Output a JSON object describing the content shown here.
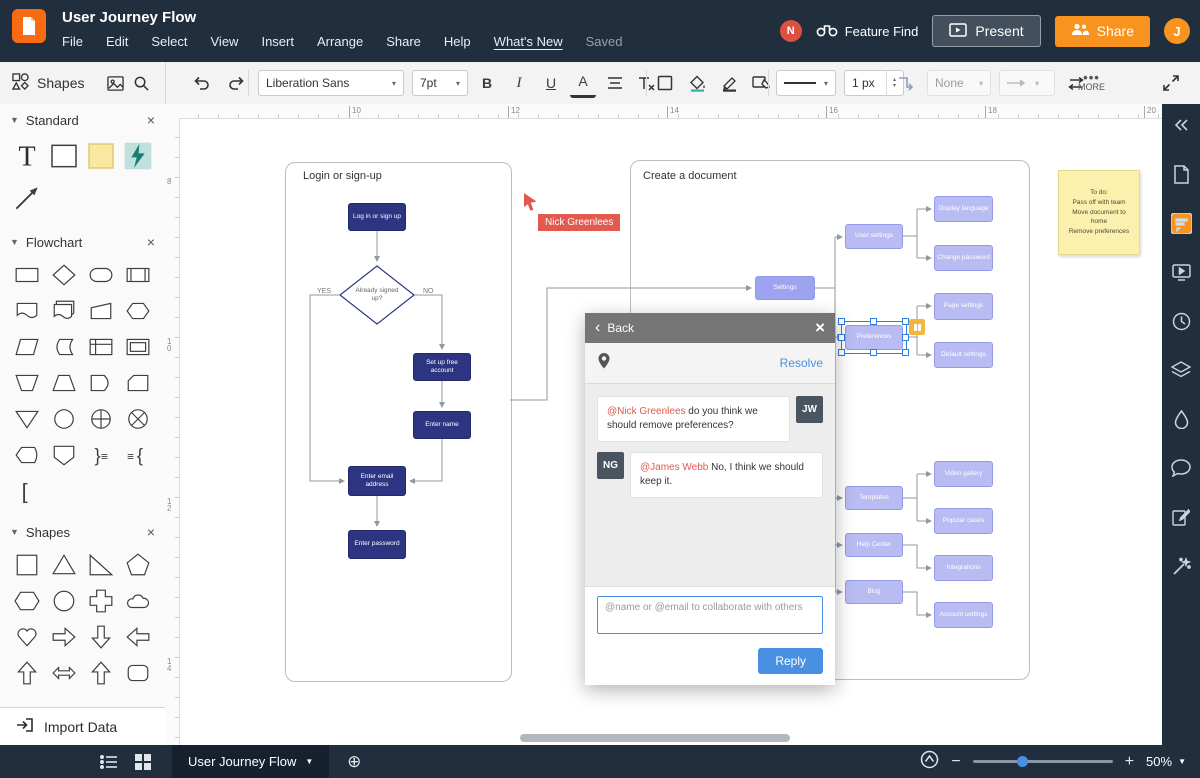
{
  "header": {
    "title": "User Journey Flow",
    "menu": [
      "File",
      "Edit",
      "Select",
      "View",
      "Insert",
      "Arrange",
      "Share",
      "Help",
      "What's New",
      "Saved"
    ],
    "avatar_small": "N",
    "feature_find": "Feature Find",
    "present": "Present",
    "share": "Share",
    "avatar_user": "J"
  },
  "toolbar": {
    "shapes_label": "Shapes",
    "font_name": "Liberation Sans",
    "font_size": "7pt",
    "bold_label": "B",
    "italic_label": "I",
    "underline_label": "U",
    "color_label": "A",
    "line_width": "1 px",
    "line_end": "None",
    "more_label": "MORE"
  },
  "left_panel": {
    "sections": [
      {
        "title": "Standard",
        "shapes": [
          "text",
          "rectangle",
          "sticky-note",
          "lightning",
          "arrow"
        ]
      },
      {
        "title": "Flowchart",
        "shapes": [
          "process",
          "decision",
          "terminator",
          "predefined-process",
          "document",
          "tagged-document",
          "manual-input",
          "preparation",
          "data",
          "stored-data",
          "internal-storage",
          "framed-rect",
          "manual-operation",
          "trapezoid",
          "delay",
          "card",
          "merge",
          "connector",
          "or-junction",
          "summing-junction",
          "display",
          "off-page",
          "brace-right",
          "brace-left",
          "bracket"
        ]
      },
      {
        "title": "Shapes",
        "shapes": [
          "square",
          "triangle",
          "right-triangle",
          "pentagon",
          "hexagon",
          "circle",
          "cross",
          "cloud",
          "heart",
          "arrow-right",
          "arrow-down",
          "arrow-left",
          "arrow-up",
          "arrow-left-right",
          "arrow-up-hollow",
          "rounded-rect"
        ]
      }
    ],
    "import_label": "Import Data"
  },
  "canvas": {
    "ruler_top_labels": [
      "10",
      "12",
      "14",
      "16",
      "18",
      "20"
    ],
    "ruler_left_labels": [
      "8",
      "10",
      "12",
      "14"
    ],
    "login_group_title": "Login or sign-up",
    "doc_group_title": "Create a document",
    "yes_label": "YES",
    "no_label": "NO",
    "login_nodes": [
      {
        "id": "login",
        "label": "Log in or sign up"
      },
      {
        "id": "signup-q",
        "label": "Already signed up?"
      },
      {
        "id": "setup",
        "label": "Set up free account"
      },
      {
        "id": "name",
        "label": "Enter name"
      },
      {
        "id": "email",
        "label": "Enter email address"
      },
      {
        "id": "password",
        "label": "Enter password"
      }
    ],
    "doc_nodes": [
      {
        "id": "settings",
        "label": "Settings"
      },
      {
        "id": "user-settings",
        "label": "User settings"
      },
      {
        "id": "display-language",
        "label": "Display language"
      },
      {
        "id": "change-password",
        "label": "Change password"
      },
      {
        "id": "page-settings",
        "label": "Page settings"
      },
      {
        "id": "preferences",
        "label": "Preferences",
        "selected": true
      },
      {
        "id": "default-settings",
        "label": "Default settings"
      },
      {
        "id": "templates",
        "label": "Templates"
      },
      {
        "id": "video-gallery",
        "label": "Video gallery"
      },
      {
        "id": "popular-cases",
        "label": "Popular cases"
      },
      {
        "id": "help-center",
        "label": "Help Center"
      },
      {
        "id": "integrations",
        "label": "Integrations"
      },
      {
        "id": "blog",
        "label": "Blog"
      },
      {
        "id": "account-settings",
        "label": "Account settings"
      }
    ],
    "cursor_label": "Nick Greenlees",
    "sticky_note_lines": [
      "To do:",
      "Pass off with team",
      "Move document to",
      "home",
      "Remove preferences"
    ]
  },
  "comment_popup": {
    "back_label": "Back",
    "resolve_label": "Resolve",
    "comments": [
      {
        "avatar": "JW",
        "mention": "@Nick Greenlees",
        "text": " do you think we should remove preferences?",
        "avatar_side": "right"
      },
      {
        "avatar": "NG",
        "mention": "@James Webb",
        "text": " No, I think we should keep it.",
        "avatar_side": "left"
      }
    ],
    "reply_placeholder": "@name or @email to collaborate with others",
    "reply_label": "Reply"
  },
  "right_rail": {
    "icons": [
      "collapse-icon",
      "document-icon",
      "comments-icon",
      "present-icon",
      "history-icon",
      "layers-icon",
      "ink-drop-icon",
      "chat-icon",
      "notes-icon",
      "magic-wand-icon"
    ]
  },
  "bottom_bar": {
    "tab_label": "User Journey Flow",
    "zoom_label": "50%"
  },
  "colors": {
    "accent_orange": "#f96b13",
    "share_orange": "#f7931e",
    "node_navy": "#2d3583",
    "node_purple": "#b9bcf3",
    "mention_red": "#e2594e",
    "link_blue": "#4a90e2",
    "selection_blue": "#2e7de0",
    "sticky_yellow": "#fcf0ae",
    "dark_chrome": "#202e3d"
  }
}
